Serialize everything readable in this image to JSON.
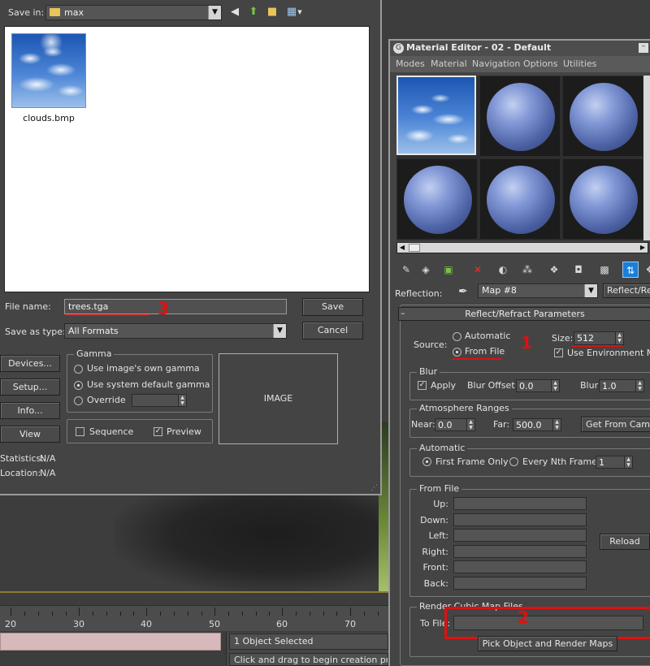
{
  "save_dialog": {
    "save_in_label": "Save in:",
    "save_in_value": "max",
    "icons": {
      "back": "back-arrow-icon",
      "up": "up-folder-icon",
      "new": "new-folder-icon",
      "views": "view-menu-icon"
    },
    "file": {
      "name": "clouds.bmp"
    },
    "file_name_label": "File name:",
    "file_name_value": "trees.tga",
    "save_type_label": "Save as type:",
    "save_type_value": "All Formats",
    "save_button": "Save",
    "cancel_button": "Cancel",
    "side_buttons": [
      "Devices...",
      "Setup...",
      "Info...",
      "View"
    ],
    "gamma": {
      "title": "Gamma",
      "options": [
        "Use image's own gamma",
        "Use system default gamma",
        "Override"
      ],
      "selected": 1
    },
    "sequence_label": "Sequence",
    "sequence_checked": false,
    "preview_label": "Preview",
    "preview_checked": true,
    "image_label": "IMAGE",
    "statistics_label": "Statistics:",
    "statistics_value": "N/A",
    "location_label": "Location:",
    "location_value": "N/A",
    "annotation": "3"
  },
  "material_editor": {
    "title": "Material Editor - 02 - Default",
    "menu": [
      "Modes",
      "Material",
      "Navigation",
      "Options",
      "Utilities"
    ],
    "reflection_label": "Reflection:",
    "map_value": "Map #8",
    "map_type": "Reflect/Refract",
    "rollout_title": "Reflect/Refract Parameters",
    "source": {
      "label": "Source:",
      "options": [
        "Automatic",
        "From File"
      ],
      "selected": 1,
      "size_label": "Size:",
      "size_value": "512",
      "use_env_label": "Use Environment Map",
      "use_env_checked": true
    },
    "blur": {
      "title": "Blur",
      "apply_label": "Apply",
      "apply_checked": true,
      "offset_label": "Blur Offset:",
      "offset_value": "0.0",
      "blur_label": "Blur:",
      "blur_value": "1.0"
    },
    "atmosphere": {
      "title": "Atmosphere Ranges",
      "near_label": "Near:",
      "near_value": "0.0",
      "far_label": "Far:",
      "far_value": "500.0",
      "camera_button": "Get From Camera"
    },
    "automatic": {
      "title": "Automatic",
      "options": [
        "First Frame Only",
        "Every Nth Frame:"
      ],
      "selected": 0,
      "nth_value": "1"
    },
    "from_file": {
      "title": "From File",
      "labels": [
        "Up:",
        "Down:",
        "Left:",
        "Right:",
        "Front:",
        "Back:"
      ],
      "reload_button": "Reload"
    },
    "render_cubic": {
      "title": "Render Cubic Map Files",
      "to_file_label": "To File:",
      "pick_button": "Pick Object and Render Maps"
    },
    "annotations": [
      "1",
      "2"
    ]
  },
  "viewport": {
    "timeline_numbers": [
      "20",
      "30",
      "40",
      "50",
      "60",
      "70"
    ],
    "status_selected": "1 Object Selected",
    "status_hint": "Click and drag to begin creation process"
  },
  "colors": {
    "annotation_red": "#e01010",
    "active_tool": "#1a7fd6",
    "sphere_blue": "#8298d6"
  }
}
